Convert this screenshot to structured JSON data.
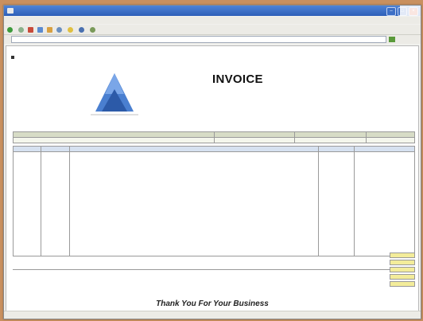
{
  "window": {
    "title": ""
  },
  "menubar": [],
  "toolbar": [
    {
      "icon": "back-icon",
      "label": ""
    },
    {
      "icon": "forward-icon",
      "label": ""
    },
    {
      "icon": "stop-icon",
      "label": ""
    },
    {
      "icon": "refresh-icon",
      "label": ""
    },
    {
      "icon": "home-icon",
      "label": ""
    },
    {
      "icon": "search-icon",
      "label": ""
    },
    {
      "icon": "favorites-icon",
      "label": ""
    },
    {
      "icon": "media-icon",
      "label": ""
    },
    {
      "icon": "history-icon",
      "label": ""
    }
  ],
  "address": {
    "label": "",
    "value": ""
  },
  "page": {
    "crumbs": "",
    "top_right": "",
    "section_title": "",
    "section_right": "",
    "logo_lines": [],
    "invoice_title": "INVOICE",
    "invoice_meta": [],
    "customer_table": {
      "headers": [],
      "row": []
    },
    "items_table": {
      "headers": [],
      "rows": [
        {
          "qty": "",
          "item": "",
          "desc": "",
          "unit": "",
          "price": ""
        }
      ]
    },
    "payable": "",
    "payable_sub": "",
    "notes": [],
    "totals": [
      {
        "label": "",
        "value": ""
      },
      {
        "label": "",
        "value": ""
      },
      {
        "label": "",
        "value": ""
      },
      {
        "label": "",
        "value": ""
      },
      {
        "label": "",
        "value": ""
      }
    ],
    "thanks": "Thank You For Your Business"
  },
  "status": {
    "text": "",
    "zone": ""
  },
  "colors": {
    "accent": "#2d5fb8",
    "header_green": "#d7dcc6",
    "header_blue": "#d6e1f0",
    "total_highlight": "#f3ec9a",
    "desktop": "#c9905f"
  }
}
